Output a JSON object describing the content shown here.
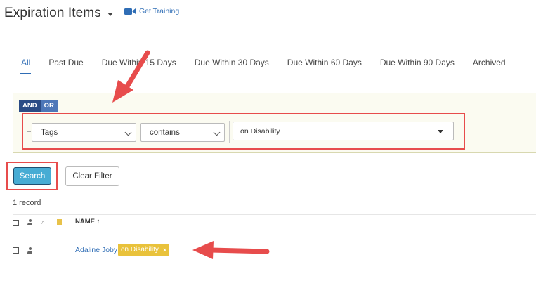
{
  "header": {
    "title": "Expiration Items",
    "training_link": "Get Training"
  },
  "tabs": [
    {
      "label": "All",
      "active": true
    },
    {
      "label": "Past Due"
    },
    {
      "label": "Due Within 15 Days"
    },
    {
      "label": "Due Within 30 Days"
    },
    {
      "label": "Due Within 60 Days"
    },
    {
      "label": "Due Within 90 Days"
    },
    {
      "label": "Archived"
    }
  ],
  "filter": {
    "and_label": "AND",
    "or_label": "OR",
    "field": "Tags",
    "operator": "contains",
    "value": "on Disability"
  },
  "buttons": {
    "search": "Search",
    "clear": "Clear Filter"
  },
  "results": {
    "count_text": "1 record",
    "columns": {
      "name": "NAME ↑"
    },
    "rows": [
      {
        "name": "Adaline Joby",
        "tag": "on Disability",
        "tag_remove": "×"
      }
    ]
  },
  "colors": {
    "accent": "#2f6db5",
    "annotation": "#e74c4c",
    "tag": "#e9c23b",
    "search_button": "#47acd4"
  }
}
